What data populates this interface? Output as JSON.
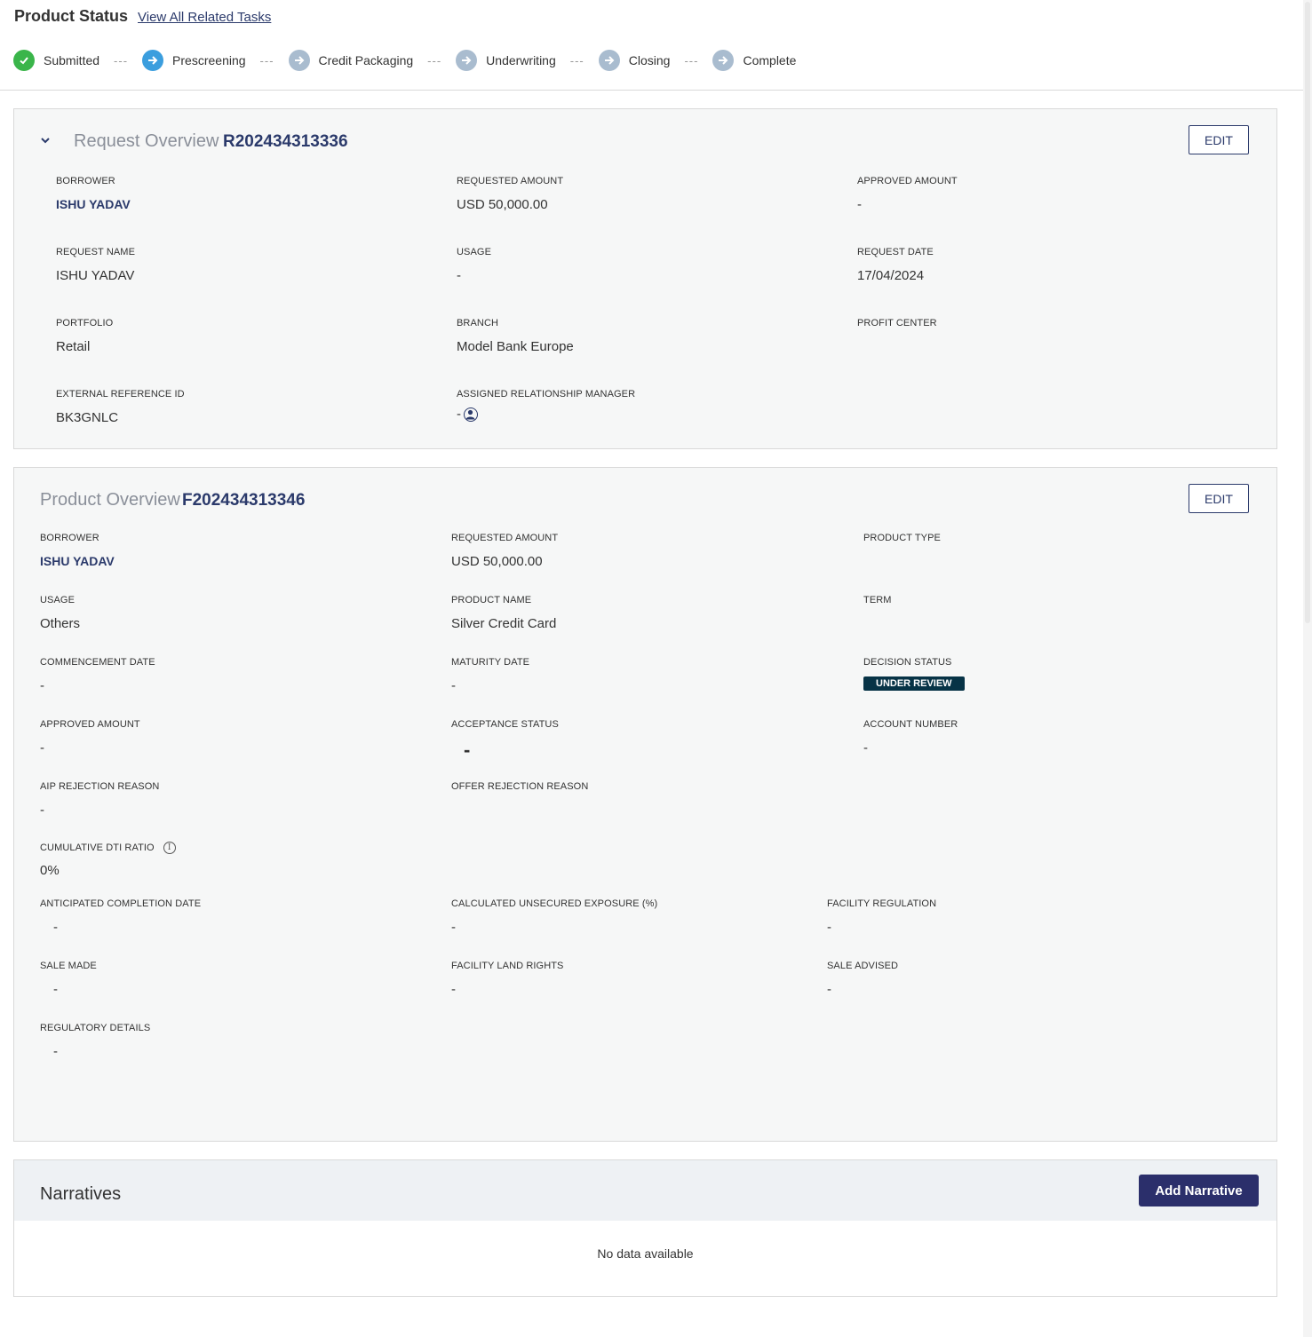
{
  "product_status": {
    "title": "Product Status",
    "view_all_link": "View All Related Tasks",
    "steps": [
      {
        "label": "Submitted",
        "state": "done"
      },
      {
        "label": "Prescreening",
        "state": "active"
      },
      {
        "label": "Credit Packaging",
        "state": "pending"
      },
      {
        "label": "Underwriting",
        "state": "pending"
      },
      {
        "label": "Closing",
        "state": "pending"
      },
      {
        "label": "Complete",
        "state": "pending"
      }
    ],
    "separator": "---"
  },
  "request_overview": {
    "title": "Request Overview",
    "id": "R202434313336",
    "edit_label": "EDIT",
    "borrower": {
      "label": "BORROWER",
      "value": "ISHU YADAV"
    },
    "requested_amount": {
      "label": "REQUESTED AMOUNT",
      "value": "USD 50,000.00"
    },
    "approved_amount": {
      "label": "APPROVED AMOUNT",
      "value": "-"
    },
    "request_name": {
      "label": "REQUEST NAME",
      "value": "ISHU YADAV"
    },
    "usage": {
      "label": "USAGE",
      "value": "-"
    },
    "request_date": {
      "label": "REQUEST DATE",
      "value": "17/04/2024"
    },
    "portfolio": {
      "label": "PORTFOLIO",
      "value": "Retail"
    },
    "branch": {
      "label": "BRANCH",
      "value": "Model Bank Europe"
    },
    "profit_center": {
      "label": "PROFIT CENTER",
      "value": ""
    },
    "external_reference_id": {
      "label": "EXTERNAL REFERENCE ID",
      "value": "BK3GNLC"
    },
    "assigned_rm": {
      "label": "ASSIGNED RELATIONSHIP MANAGER",
      "value": "-"
    }
  },
  "product_overview": {
    "title": "Product Overview",
    "id": "F202434313346",
    "edit_label": "EDIT",
    "borrower": {
      "label": "BORROWER",
      "value": "ISHU YADAV"
    },
    "requested_amount": {
      "label": "REQUESTED AMOUNT",
      "value": "USD 50,000.00"
    },
    "product_type": {
      "label": "PRODUCT TYPE",
      "value": ""
    },
    "usage": {
      "label": "USAGE",
      "value": "Others"
    },
    "product_name": {
      "label": "PRODUCT NAME",
      "value": "Silver Credit Card"
    },
    "term": {
      "label": "TERM",
      "value": ""
    },
    "commencement_date": {
      "label": "COMMENCEMENT DATE",
      "value": "-"
    },
    "maturity_date": {
      "label": "MATURITY DATE",
      "value": "-"
    },
    "decision_status": {
      "label": "DECISION STATUS",
      "value": "UNDER REVIEW"
    },
    "approved_amount": {
      "label": "APPROVED AMOUNT",
      "value": "-"
    },
    "acceptance_status": {
      "label": "ACCEPTANCE STATUS",
      "value": "-"
    },
    "account_number": {
      "label": "ACCOUNT NUMBER",
      "value": "-"
    },
    "aip_rejection_reason": {
      "label": "AIP REJECTION REASON",
      "value": "-"
    },
    "offer_rejection_reason": {
      "label": "OFFER REJECTION REASON",
      "value": ""
    },
    "cumulative_dti_ratio": {
      "label": "CUMULATIVE DTI RATIO",
      "value": "0%"
    },
    "anticipated_completion_date": {
      "label": "ANTICIPATED COMPLETION DATE",
      "value": "-"
    },
    "calculated_unsecured_exposure": {
      "label": "CALCULATED UNSECURED EXPOSURE (%)",
      "value": "-"
    },
    "facility_regulation": {
      "label": "FACILITY REGULATION",
      "value": "-"
    },
    "sale_made": {
      "label": "SALE MADE",
      "value": "-"
    },
    "facility_land_rights": {
      "label": "FACILITY LAND RIGHTS",
      "value": "-"
    },
    "sale_advised": {
      "label": "SALE ADVISED",
      "value": "-"
    },
    "regulatory_details": {
      "label": "REGULATORY DETAILS",
      "value": "-"
    }
  },
  "narratives": {
    "title": "Narratives",
    "add_label": "Add Narrative",
    "empty_text": "No data available"
  },
  "colors": {
    "primary": "#2b3a6b",
    "step_done": "#3ab54a",
    "step_active": "#3b9ede",
    "step_pending": "#a9bccf",
    "badge": "#073346"
  },
  "icons": {
    "step_done": "check-icon",
    "step_other": "arrow-right-icon",
    "collapse": "chevron-down-icon",
    "info": "info-icon",
    "rm": "user-avatar-icon"
  }
}
